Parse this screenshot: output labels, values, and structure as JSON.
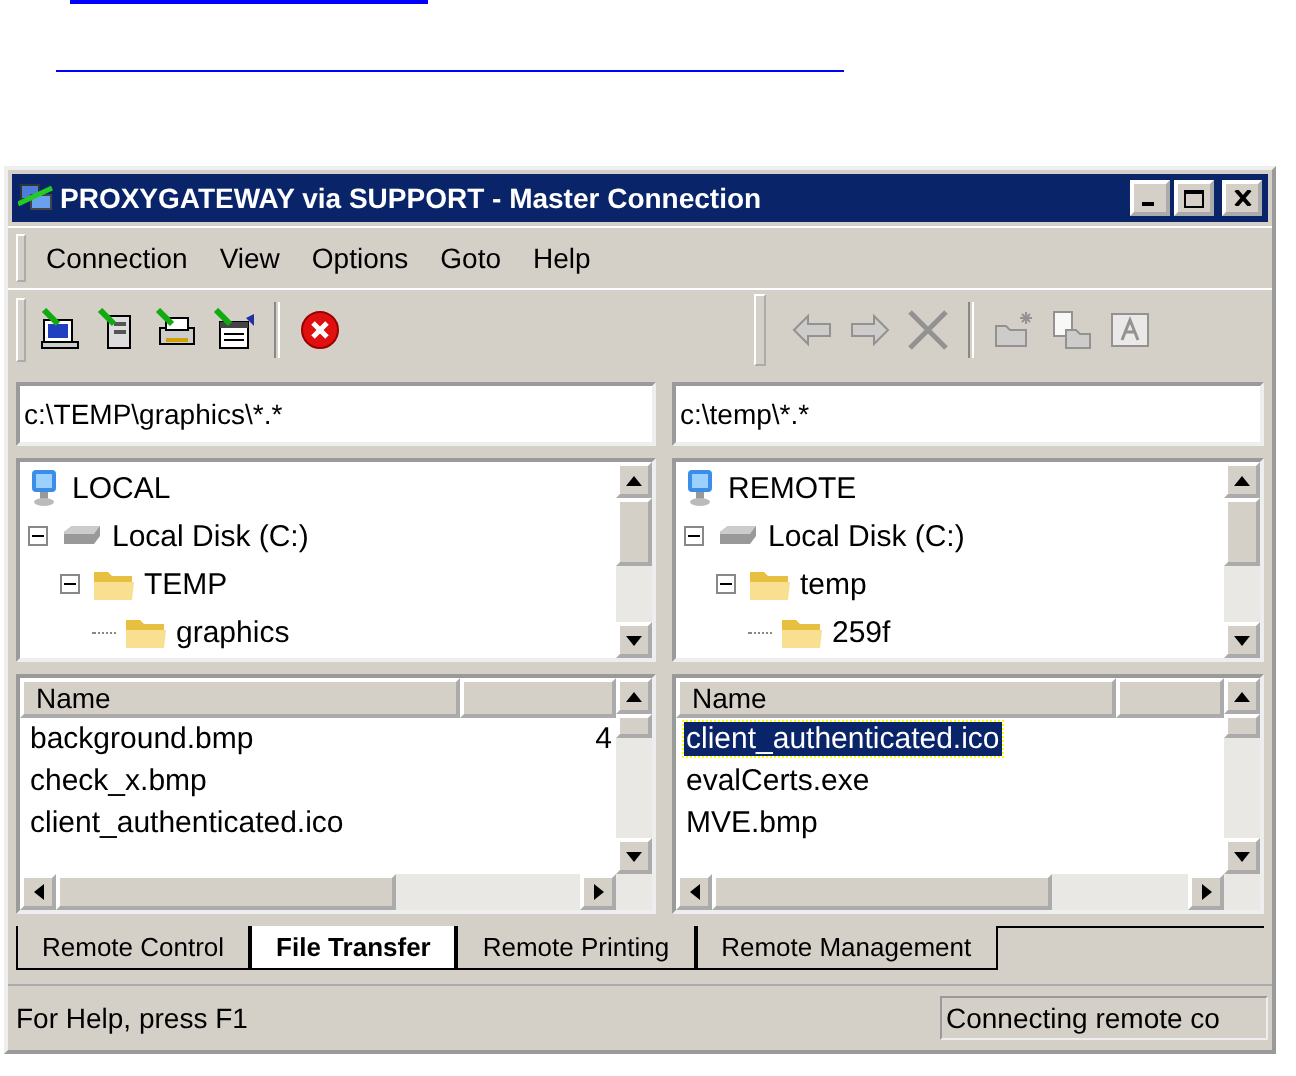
{
  "window": {
    "title": "PROXYGATEWAY via SUPPORT - Master Connection"
  },
  "menu": [
    "Connection",
    "View",
    "Options",
    "Goto",
    "Help"
  ],
  "toolbar_left": [
    {
      "kind": "monitor",
      "disabled": false
    },
    {
      "kind": "tower",
      "disabled": false
    },
    {
      "kind": "printer",
      "disabled": false
    },
    {
      "kind": "manage",
      "disabled": false
    },
    {
      "kind": "stop",
      "disabled": false
    }
  ],
  "toolbar_right": [
    {
      "kind": "back",
      "disabled": true
    },
    {
      "kind": "forward",
      "disabled": true
    },
    {
      "kind": "delete",
      "disabled": true
    },
    {
      "kind": "newfolder",
      "disabled": true
    },
    {
      "kind": "copy",
      "disabled": true
    },
    {
      "kind": "rename",
      "disabled": true
    }
  ],
  "panes": [
    {
      "path": "c:\\TEMP\\graphics\\*.*",
      "tree": [
        {
          "label": "LOCAL",
          "kind": "computer",
          "children": [
            {
              "label": "Local Disk (C:)",
              "kind": "disk",
              "expanded": true,
              "children": [
                {
                  "label": "TEMP",
                  "kind": "folder",
                  "expanded": true,
                  "children": [
                    {
                      "label": "graphics",
                      "kind": "folder"
                    }
                  ]
                }
              ]
            }
          ]
        }
      ],
      "list": {
        "columns": [
          "Name"
        ],
        "rows": [
          {
            "name": "background.bmp",
            "size": "4",
            "selected": false
          },
          {
            "name": "check_x.bmp",
            "selected": false
          },
          {
            "name": "client_authenticated.ico",
            "selected": false
          }
        ]
      }
    },
    {
      "path": "c:\\temp\\*.*",
      "tree": [
        {
          "label": "REMOTE",
          "kind": "computer",
          "children": [
            {
              "label": "Local Disk (C:)",
              "kind": "disk",
              "expanded": true,
              "children": [
                {
                  "label": "temp",
                  "kind": "folder",
                  "expanded": true,
                  "children": [
                    {
                      "label": "259f",
                      "kind": "folder"
                    }
                  ]
                }
              ]
            }
          ]
        }
      ],
      "list": {
        "columns": [
          "Name"
        ],
        "rows": [
          {
            "name": "client_authenticated.ico",
            "selected": true
          },
          {
            "name": "evalCerts.exe",
            "selected": false
          },
          {
            "name": "MVE.bmp",
            "selected": false
          }
        ]
      }
    }
  ],
  "tabs": [
    {
      "label": "Remote Control",
      "selected": false
    },
    {
      "label": "File Transfer",
      "selected": true
    },
    {
      "label": "Remote Printing",
      "selected": false
    },
    {
      "label": "Remote Management",
      "selected": false
    }
  ],
  "status_bar": {
    "help": "For Help, press F1",
    "status": "Connecting remote co"
  }
}
